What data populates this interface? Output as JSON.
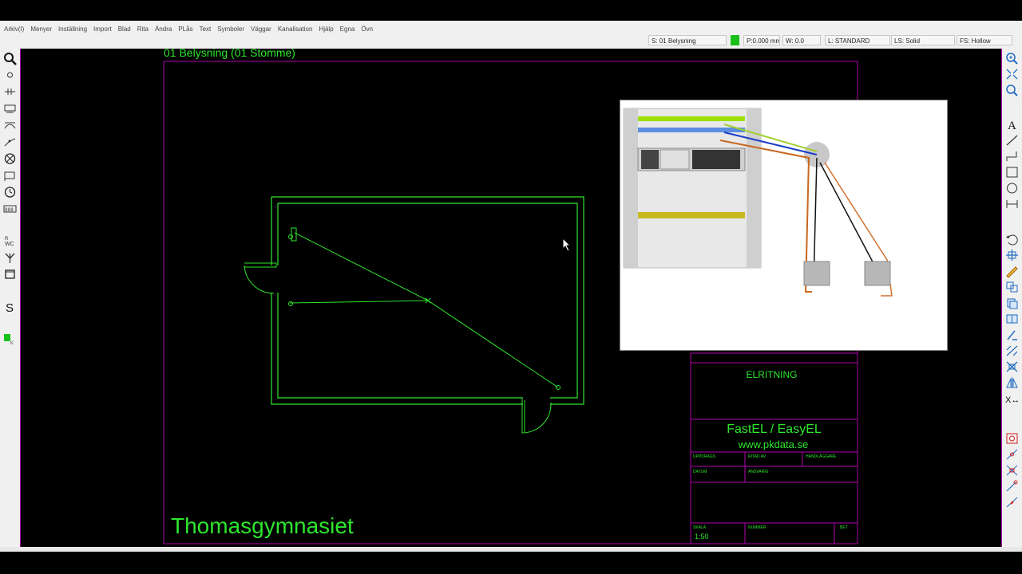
{
  "menu": [
    "Arkiv(I)",
    "Menyer",
    "Inställning",
    "Import",
    "Blad",
    "Rita",
    "Ändra",
    "PLås",
    "Text",
    "Symboler",
    "Väggar",
    "Kanalisation",
    "Hjälp",
    "Egna",
    "Övn"
  ],
  "status": {
    "symbol": "S: 01 Belysning",
    "pen": "P:0.000 mm",
    "width": "W: 0.0",
    "layer": "L: STANDARD",
    "line_style": "LS: Solid",
    "fill_style": "FS: Hollow",
    "layer_color": "#19c019"
  },
  "drawing": {
    "layer_title": "01 Belysning (01 Stomme)",
    "site_name": "Thomasgymnasiet",
    "line_color": "#2ee62e",
    "frame_color": "#b000b0"
  },
  "titleblock": {
    "drawing_type": "ELRITNING",
    "company": "FastEL / EasyEL",
    "website": "www.pkdata.se",
    "scale_label": "SKALA",
    "scale_value": "1:50",
    "number_label": "NUMMER",
    "rev_label": "BET",
    "client_label": "UPPDRAGS",
    "drawn_label": "RITAD AV",
    "handler_label": "HANDLÄGGARE",
    "date_label": "DATUM",
    "resp_label": "ANSVARIG"
  }
}
